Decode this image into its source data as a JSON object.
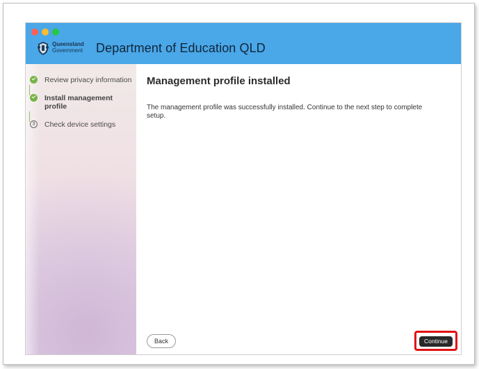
{
  "window": {
    "department_title": "Department of Education QLD",
    "logo": {
      "line1": "Queensland",
      "line2": "Government",
      "icon": "queensland-crest-icon"
    },
    "traffic_lights": [
      "close",
      "minimize",
      "zoom"
    ]
  },
  "sidebar": {
    "steps": [
      {
        "label": "Review privacy information",
        "status": "completed",
        "icon": "check-circle-icon"
      },
      {
        "label": "Install management profile",
        "status": "current",
        "icon": "check-circle-icon"
      },
      {
        "label": "Check device settings",
        "status": "upcoming",
        "number": "3"
      }
    ]
  },
  "main": {
    "heading": "Management profile installed",
    "message": "The management profile was successfully installed. Continue to the next step to complete setup."
  },
  "actions": {
    "back": "Back",
    "continue": "Continue"
  },
  "colors": {
    "titlebar": "#4aa7e8",
    "step_complete": "#76b447",
    "highlight": "#e01111",
    "continue_button": "#292929"
  }
}
